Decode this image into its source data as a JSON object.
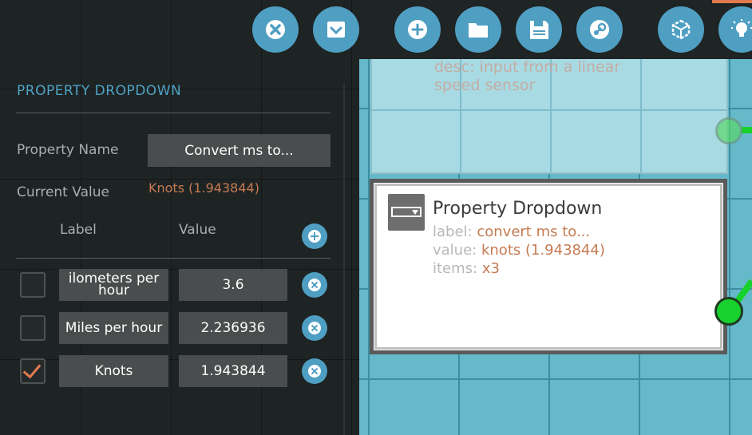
{
  "panel": {
    "title": "PROPERTY DROPDOWN",
    "property_name_label": "Property Name",
    "property_name_value": "Convert ms to...",
    "current_value_label": "Current Value",
    "current_value": "Knots (1.943844)",
    "col_label": "Label",
    "col_value": "Value",
    "items": [
      {
        "label": "ilometers per hour",
        "value": "3.6",
        "checked": false
      },
      {
        "label": "Miles per hour",
        "value": "2.236936",
        "checked": false
      },
      {
        "label": "Knots",
        "value": "1.943844",
        "checked": true
      }
    ]
  },
  "node_top": {
    "desc": "desc: input from a linear speed sensor"
  },
  "node": {
    "title": "Property Dropdown",
    "label_key": "label:",
    "label_val": "convert ms to...",
    "value_key": "value:",
    "value_val": "knots (1.943844)",
    "items_key": "items:",
    "items_val": "x3"
  },
  "toolbar": {
    "buttons": [
      "close-icon",
      "inbox-icon",
      "add-icon",
      "folder-icon",
      "save-icon",
      "steam-icon",
      "cube-icon",
      "lightbulb-icon"
    ]
  },
  "colors": {
    "accent": "#4f9fc3",
    "value_orange": "#c67b52",
    "canvas": "#66b9c9",
    "port": "#17d12c"
  }
}
